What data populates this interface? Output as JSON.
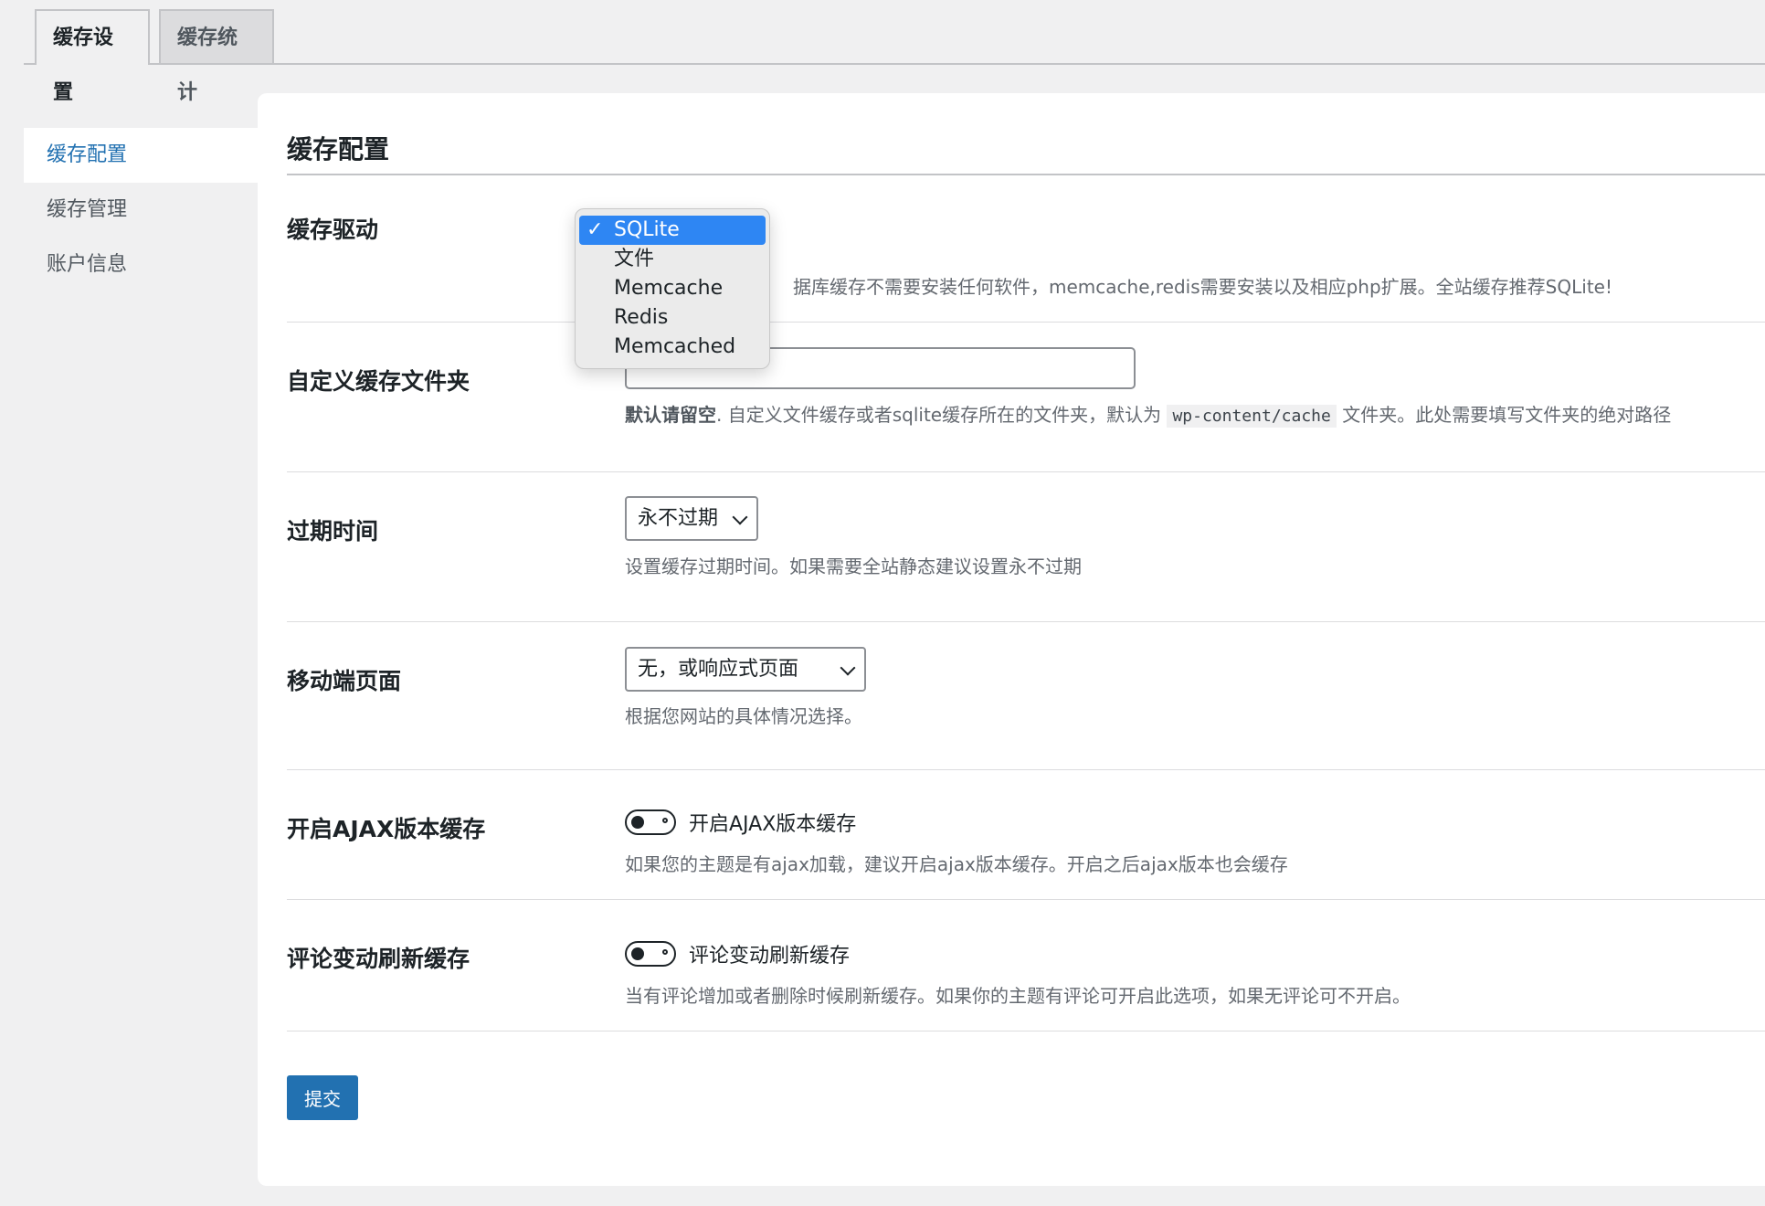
{
  "tabs": [
    {
      "label": "缓存设置",
      "active": true
    },
    {
      "label": "缓存统计",
      "active": false
    }
  ],
  "sidebar": {
    "items": [
      {
        "label": "缓存配置",
        "active": true
      },
      {
        "label": "缓存管理",
        "active": false
      },
      {
        "label": "账户信息",
        "active": false
      }
    ]
  },
  "main": {
    "section_title": "缓存配置",
    "cache_driver": {
      "label": "缓存驱动",
      "options": [
        "SQLite",
        "文件",
        "Memcache",
        "Redis",
        "Memcached"
      ],
      "selected": "SQLite",
      "check_glyph": "✓",
      "desc": "据库缓存不需要安装任何软件，memcache,redis需要安装以及相应php扩展。全站缓存推荐SQLite!"
    },
    "custom_folder": {
      "label": "自定义缓存文件夹",
      "value": "",
      "desc_bold": "默认请留空",
      "desc_part1": ". 自定义文件缓存或者sqlite缓存所在的文件夹，默认为",
      "desc_code": "wp-content/cache",
      "desc_part2": "文件夹。此处需要填写文件夹的绝对路径"
    },
    "expire": {
      "label": "过期时间",
      "selected": "永不过期",
      "desc": "设置缓存过期时间。如果需要全站静态建议设置永不过期"
    },
    "mobile": {
      "label": "移动端页面",
      "selected": "无，或响应式页面",
      "desc": "根据您网站的具体情况选择。"
    },
    "ajax_cache": {
      "label": "开启AJAX版本缓存",
      "toggle_label": "开启AJAX版本缓存",
      "enabled": false,
      "desc": "如果您的主题是有ajax加载，建议开启ajax版本缓存。开启之后ajax版本也会缓存"
    },
    "comment_refresh": {
      "label": "评论变动刷新缓存",
      "toggle_label": "评论变动刷新缓存",
      "enabled": false,
      "desc": "当有评论增加或者删除时候刷新缓存。如果你的主题有评论可开启此选项，如果无评论可不开启。"
    },
    "submit_label": "提交"
  },
  "colors": {
    "accent": "#2271b1",
    "dropdown_highlight": "#2e86f3",
    "background": "#f0f0f1"
  }
}
